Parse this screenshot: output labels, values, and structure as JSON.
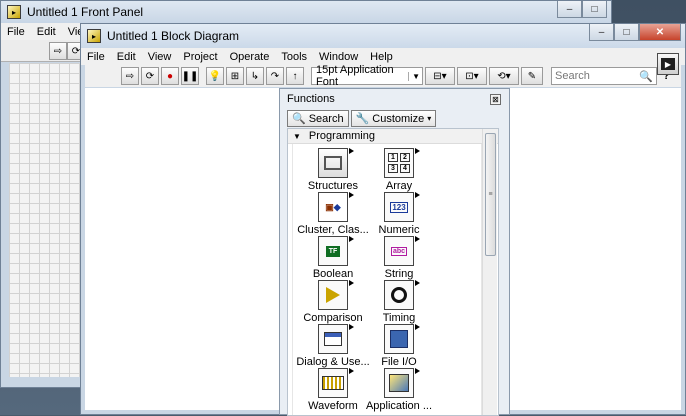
{
  "front_panel": {
    "title": "Untitled 1 Front Panel",
    "menus": [
      "File",
      "Edit",
      "Vie"
    ]
  },
  "block_diagram": {
    "title": "Untitled 1 Block Diagram",
    "menus": [
      "File",
      "Edit",
      "View",
      "Project",
      "Operate",
      "Tools",
      "Window",
      "Help"
    ],
    "font_select": "15pt Application Font",
    "search_placeholder": "Search"
  },
  "functions_palette": {
    "title": "Functions",
    "search_label": "Search",
    "customize_label": "Customize",
    "category": "Programming",
    "items": [
      {
        "label": "Structures",
        "icon": "structures-icon"
      },
      {
        "label": "Array",
        "icon": "array-icon"
      },
      {
        "label": "Cluster, Clas...",
        "icon": "cluster-icon"
      },
      {
        "label": "Numeric",
        "icon": "numeric-icon"
      },
      {
        "label": "Boolean",
        "icon": "boolean-icon"
      },
      {
        "label": "String",
        "icon": "string-icon"
      },
      {
        "label": "Comparison",
        "icon": "comparison-icon"
      },
      {
        "label": "Timing",
        "icon": "timing-icon"
      },
      {
        "label": "Dialog & Use...",
        "icon": "dialog-icon"
      },
      {
        "label": "File I/O",
        "icon": "file-io-icon"
      },
      {
        "label": "Waveform",
        "icon": "waveform-icon"
      },
      {
        "label": "Application ...",
        "icon": "application-control-icon"
      }
    ]
  }
}
